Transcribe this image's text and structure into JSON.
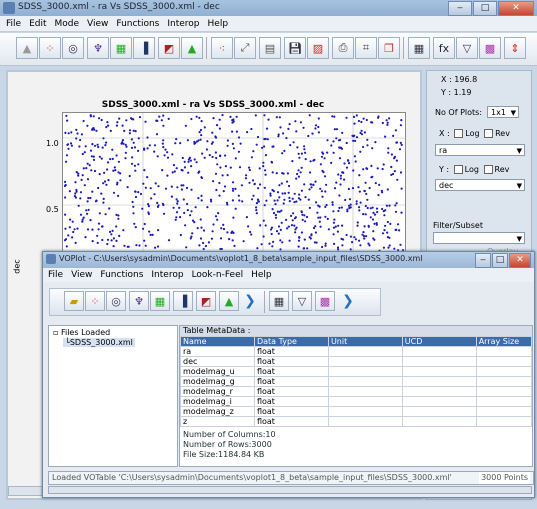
{
  "main_window": {
    "title": "SDSS_3000.xml - ra   Vs  SDSS_3000.xml - dec",
    "menus": [
      "File",
      "Edit",
      "Mode",
      "View",
      "Functions",
      "Interop",
      "Help"
    ]
  },
  "plot": {
    "title": "SDSS_3000.xml - ra   Vs  SDSS_3000.xml - dec",
    "y_axis_label": "dec",
    "y_ticks": [
      "1.0",
      "0.5"
    ]
  },
  "side_panel": {
    "x_readout": "X : 196.8",
    "y_readout": "Y : 1.19",
    "no_of_plots_label": "No Of Plots:",
    "no_of_plots_value": "1x1",
    "x_label": "X :",
    "y_label": "Y :",
    "log_label": "Log",
    "rev_label": "Rev",
    "x_column": "ra",
    "y_column": "dec",
    "filter_label": "Filter/Subset",
    "overlay_label": "Overlay"
  },
  "votable_window": {
    "title": "VOPlot - C:\\Users\\sysadmin\\Documents\\voplot1_8_beta\\sample_input_files\\SDSS_3000.xml",
    "menus": [
      "File",
      "View",
      "Functions",
      "Interop",
      "Look-n-Feel",
      "Help"
    ],
    "tree_root": "Files Loaded",
    "tree_file": "SDSS_3000.xml",
    "metadata_heading": "Table MetaData :",
    "columns": [
      "Name",
      "Data Type",
      "Unit",
      "UCD",
      "Array Size"
    ],
    "rows": [
      [
        "ra",
        "float",
        "",
        "",
        ""
      ],
      [
        "dec",
        "float",
        "",
        "",
        ""
      ],
      [
        "modelmag_u",
        "float",
        "",
        "",
        ""
      ],
      [
        "modelmag_g",
        "float",
        "",
        "",
        ""
      ],
      [
        "modelmag_r",
        "float",
        "",
        "",
        ""
      ],
      [
        "modelmag_i",
        "float",
        "",
        "",
        ""
      ],
      [
        "modelmag_z",
        "float",
        "",
        "",
        ""
      ],
      [
        "z",
        "float",
        "",
        "",
        ""
      ]
    ],
    "num_columns": "Number of Columns:10",
    "num_rows": "Number of Rows:3000",
    "file_size": "File Size:1184.84 KB",
    "status": "Loaded VOTable 'C:\\Users\\sysadmin\\Documents\\voplot1_8_beta\\sample_input_files\\SDSS_3000.xml'",
    "points": "3000 Points"
  },
  "colors": {
    "accent": "#3d6aa8",
    "points": "#1a1ab8"
  }
}
